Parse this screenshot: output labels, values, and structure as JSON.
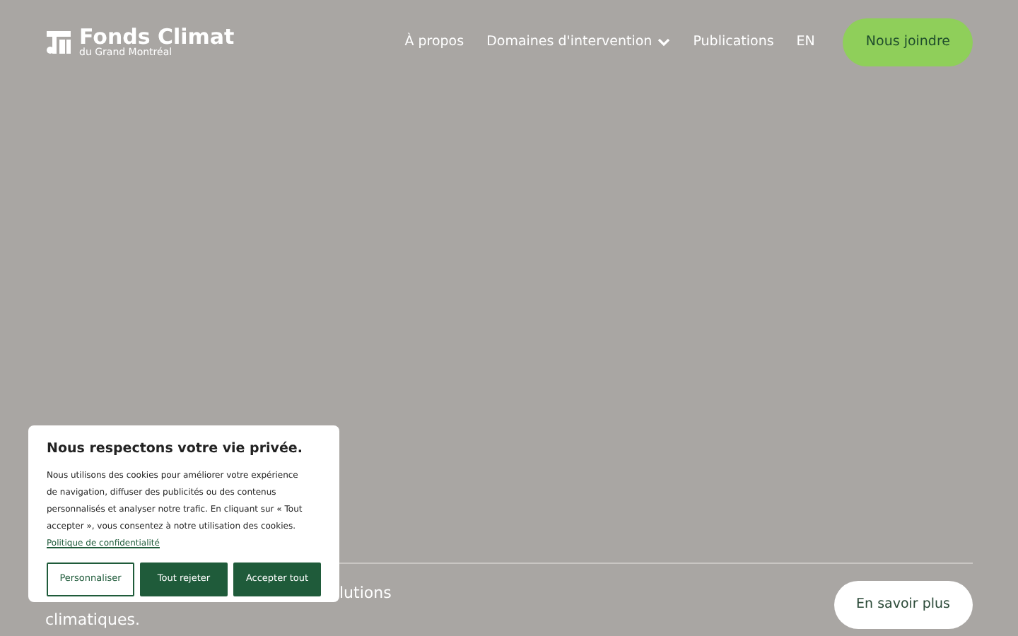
{
  "header": {
    "logo": {
      "title": "Fonds Climat",
      "subtitle": "du Grand Montréal"
    },
    "nav": [
      {
        "label": "À propos",
        "kind": "link"
      },
      {
        "label": "Domaines d'intervention",
        "kind": "dropdown",
        "expanded": false
      },
      {
        "label": "Publications",
        "kind": "link"
      },
      {
        "label": "EN",
        "kind": "link"
      }
    ],
    "cta": "Nous joindre"
  },
  "hero": {
    "text_line_1": "lutions",
    "text_line_2": "climatiques.",
    "button": "En savoir plus"
  },
  "cookie_banner": {
    "title": "Nous respectons votre vie privée.",
    "body": "Nous utilisons des cookies pour améliorer votre expérience de navigation, diffuser des publicités ou des contenus personnalisés et analyser notre trafic. En cliquant sur « Tout accepter », vous consentez à notre utilisation des cookies.",
    "link": "Politique de confidentialité",
    "buttons": [
      {
        "label": "Personnaliser",
        "kind": "outline"
      },
      {
        "label": "Tout rejeter",
        "kind": "solid"
      },
      {
        "label": "Accepter tout",
        "kind": "solid"
      }
    ]
  }
}
